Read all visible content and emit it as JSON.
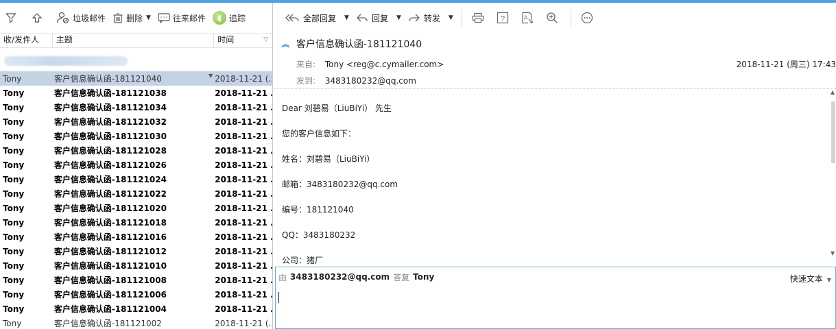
{
  "colors": {
    "accent": "#4ba3e3",
    "selected_row": "#c4d3e4",
    "reply_border": "#6fa7d9"
  },
  "left_toolbar": {
    "filter_icon": "filter-icon",
    "moveup_icon": "move-up-icon",
    "junk_label": "垃圾邮件",
    "delete_label": "删除",
    "related_label": "往来邮件",
    "track_label": "追踪"
  },
  "columns": {
    "from": "收/发件人",
    "subject": "主题",
    "time": "时间"
  },
  "messages": [
    {
      "from": "Tony",
      "subject": "客户信息确认函-181121040",
      "time": "2018-11-21 (...",
      "unread": false,
      "selected": true
    },
    {
      "from": "Tony",
      "subject": "客户信息确认函-181121038",
      "time": "2018-11-21 ...",
      "unread": true,
      "selected": false
    },
    {
      "from": "Tony",
      "subject": "客户信息确认函-181121034",
      "time": "2018-11-21 ...",
      "unread": true,
      "selected": false
    },
    {
      "from": "Tony",
      "subject": "客户信息确认函-181121032",
      "time": "2018-11-21 ...",
      "unread": true,
      "selected": false
    },
    {
      "from": "Tony",
      "subject": "客户信息确认函-181121030",
      "time": "2018-11-21 ...",
      "unread": true,
      "selected": false
    },
    {
      "from": "Tony",
      "subject": "客户信息确认函-181121028",
      "time": "2018-11-21 ...",
      "unread": true,
      "selected": false
    },
    {
      "from": "Tony",
      "subject": "客户信息确认函-181121026",
      "time": "2018-11-21 ...",
      "unread": true,
      "selected": false
    },
    {
      "from": "Tony",
      "subject": "客户信息确认函-181121024",
      "time": "2018-11-21 ...",
      "unread": true,
      "selected": false
    },
    {
      "from": "Tony",
      "subject": "客户信息确认函-181121022",
      "time": "2018-11-21 ...",
      "unread": true,
      "selected": false
    },
    {
      "from": "Tony",
      "subject": "客户信息确认函-181121020",
      "time": "2018-11-21 ...",
      "unread": true,
      "selected": false
    },
    {
      "from": "Tony",
      "subject": "客户信息确认函-181121018",
      "time": "2018-11-21 ...",
      "unread": true,
      "selected": false
    },
    {
      "from": "Tony",
      "subject": "客户信息确认函-181121016",
      "time": "2018-11-21 ...",
      "unread": true,
      "selected": false
    },
    {
      "from": "Tony",
      "subject": "客户信息确认函-181121012",
      "time": "2018-11-21 ...",
      "unread": true,
      "selected": false
    },
    {
      "from": "Tony",
      "subject": "客户信息确认函-181121010",
      "time": "2018-11-21 ...",
      "unread": true,
      "selected": false
    },
    {
      "from": "Tony",
      "subject": "客户信息确认函-181121008",
      "time": "2018-11-21 ...",
      "unread": true,
      "selected": false
    },
    {
      "from": "Tony",
      "subject": "客户信息确认函-181121006",
      "time": "2018-11-21 ...",
      "unread": true,
      "selected": false
    },
    {
      "from": "Tony",
      "subject": "客户信息确认函-181121004",
      "time": "2018-11-21 ...",
      "unread": true,
      "selected": false
    },
    {
      "from": "Tony",
      "subject": "客户信息确认函-181121002",
      "time": "2018-11-21 (...",
      "unread": false,
      "selected": false
    }
  ],
  "right_toolbar": {
    "reply_all_label": "全部回复",
    "reply_label": "回复",
    "forward_label": "转发"
  },
  "message": {
    "subject": "客户信息确认函-181121040",
    "from_key": "来自:",
    "from_value": "Tony <reg@c.cymailer.com>",
    "to_key": "发到:",
    "to_value": "3483180232@qq.com",
    "date": "2018-11-21 (周三) 17:43",
    "body": [
      "Dear 刘碧易（LiuBiYi） 先生",
      "您的客户信息如下：",
      "姓名：刘碧易（LiuBiYi）",
      "邮箱：3483180232@qq.com",
      "编号：181121040",
      "QQ：3483180232",
      "公司：猪厂"
    ]
  },
  "reply_box": {
    "by_label": "由",
    "from_addr": "3483180232@qq.com",
    "reply_word": "答复",
    "to_name": "Tony",
    "quick_text_label": "快速文本"
  }
}
